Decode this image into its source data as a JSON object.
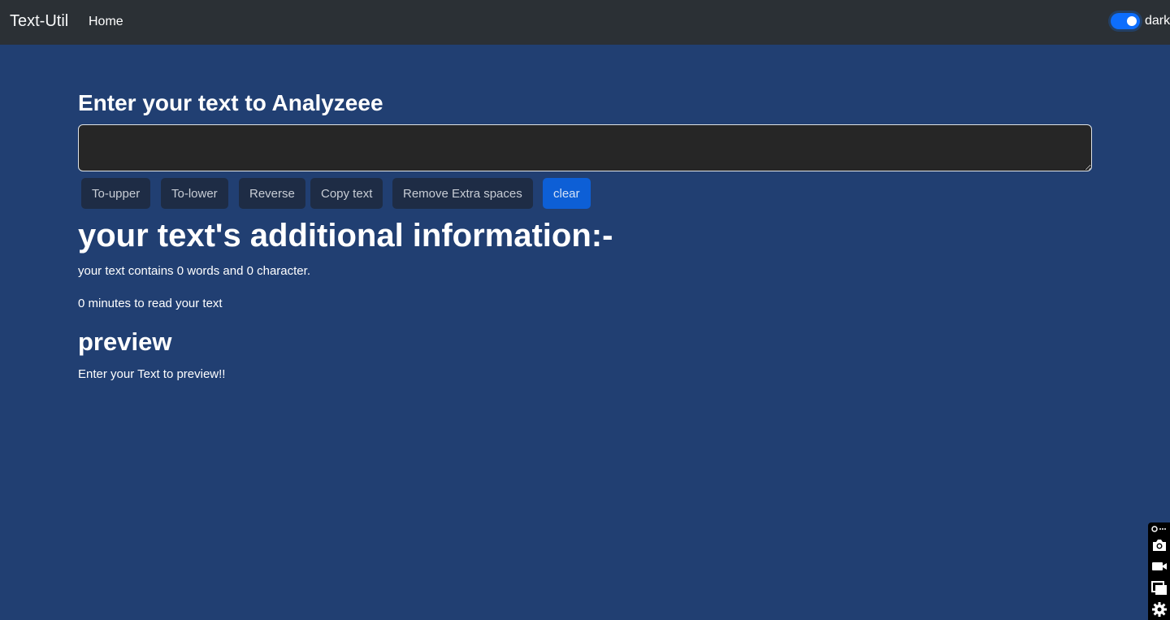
{
  "navbar": {
    "brand": "Text-Util",
    "home_label": "Home",
    "mode_toggle_label": "dark",
    "mode_toggle_on": true
  },
  "main": {
    "heading": "Enter your text to Analyzeee",
    "textarea_value": "",
    "buttons": [
      {
        "label": "To-upper"
      },
      {
        "label": "To-lower"
      },
      {
        "label": "Reverse"
      },
      {
        "label": "Copy text"
      },
      {
        "label": "Remove Extra spaces"
      },
      {
        "label": "clear"
      }
    ]
  },
  "summary": {
    "heading": "your text's additional information:-",
    "word_count_text": "your text contains 0 words and 0 character.",
    "read_time_text": "0 minutes to read your text"
  },
  "preview": {
    "heading": "preview",
    "text": "Enter your Text to preview!!"
  },
  "side_toolbar": {
    "icons": [
      "settings-small-icon",
      "camera-icon",
      "video-icon",
      "windows-icon",
      "gear-icon"
    ]
  },
  "colors": {
    "background": "#213f72",
    "navbar": "#2b3035",
    "accent": "#0d6efd"
  }
}
